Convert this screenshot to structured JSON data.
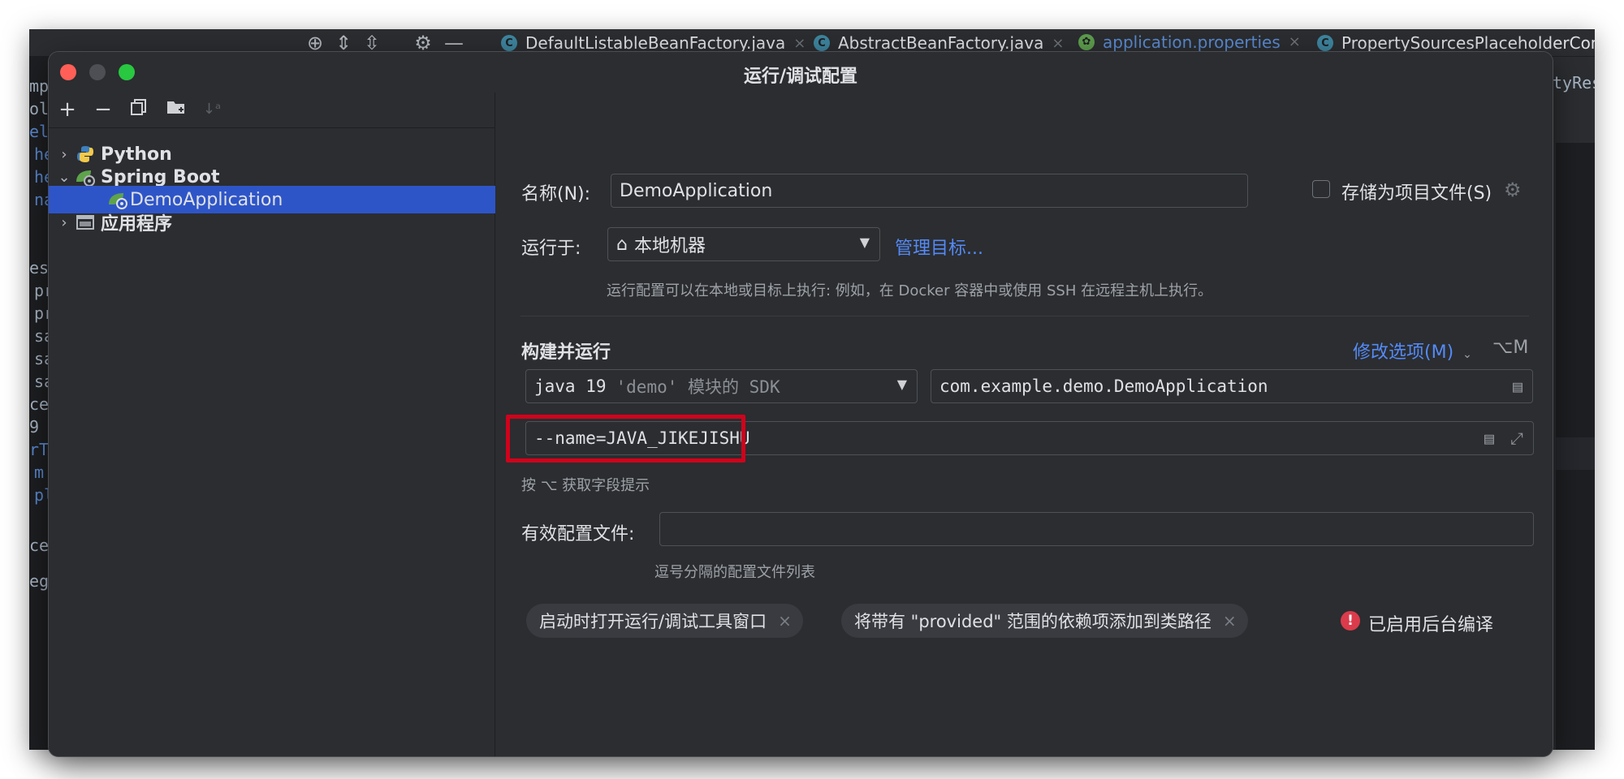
{
  "ide": {
    "tabs": [
      {
        "label": "DefaultListableBeanFactory.java"
      },
      {
        "label": "AbstractBeanFactory.java"
      },
      {
        "label": "application.properties"
      },
      {
        "label": "PropertySourcesPlaceholderConf"
      }
    ],
    "left_fragments": [
      "mp",
      "oll",
      "ello",
      "he",
      "he",
      "na",
      "est",
      "pr",
      "pr",
      "sa",
      "sa",
      "sa",
      "cep",
      "9",
      "rTh",
      "m",
      "pl",
      "ce",
      "egy"
    ],
    "right_fragment": "tyRes"
  },
  "dialog": {
    "title": "运行/调试配置",
    "toolbar": {
      "add": "+",
      "remove": "−",
      "sort": "↓ᵃ"
    },
    "tree": [
      {
        "label": "Python",
        "arrow": "›"
      },
      {
        "label": "Spring Boot",
        "arrow": "⌄"
      },
      {
        "label": "DemoApplication"
      },
      {
        "label": "应用程序",
        "arrow": "›"
      }
    ],
    "form": {
      "name_label": "名称(N):",
      "name_value": "DemoApplication",
      "store_label": "存储为项目文件(S)",
      "run_on_label": "运行于:",
      "run_on_value": "本地机器",
      "manage_targets": "管理目标...",
      "run_on_hint": "运行配置可以在本地或目标上执行: 例如，在 Docker 容器中或使用 SSH 在远程主机上执行。",
      "build_run_label": "构建并运行",
      "modify_options": "修改选项(M)",
      "modify_shortcut": "⌥M",
      "sdk_main": "java 19",
      "sdk_module": "'demo' 模块的 SDK",
      "main_class": "com.example.demo.DemoApplication",
      "program_args": "--name=JAVA_JIKEJISHU",
      "args_hint": "按 ⌥ 获取字段提示",
      "active_profiles_label": "有效配置文件:",
      "active_profiles_value": "",
      "profiles_hint": "逗号分隔的配置文件列表",
      "chips": [
        {
          "label": "启动时打开运行/调试工具窗口"
        },
        {
          "label": "将带有 \"provided\" 范围的依赖项添加到类路径"
        }
      ],
      "background_compile": "已启用后台编译"
    }
  },
  "colors": {
    "accent": "#548af7",
    "selected": "#2e55c8",
    "highlight_box": "#d0021b",
    "error": "#db3b4b"
  }
}
